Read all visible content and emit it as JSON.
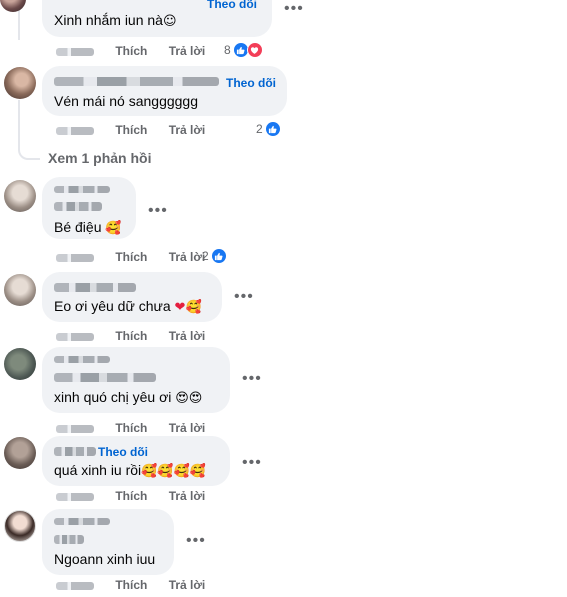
{
  "action_labels": {
    "like": "Thích",
    "reply": "Trả lời"
  },
  "follow_label": "Theo dõi",
  "view_replies_label": "Xem 1 phản hồi",
  "comments": [
    {
      "text": "Xinh nhắm iun nà",
      "emoji": "☺",
      "reaction_count": "8",
      "reactions": [
        "like",
        "love"
      ]
    },
    {
      "text": "Vén mái nó sangggggg",
      "reaction_count": "2",
      "reactions": [
        "like"
      ]
    },
    {
      "text": "Bé điệu",
      "emoji": "🥰",
      "reaction_count": "2",
      "reactions": [
        "like"
      ]
    },
    {
      "text": "Eo ơi yêu dữ chưa",
      "emoji": "❤🥰"
    },
    {
      "text": "xinh quó chị yêu ơi",
      "emoji": "😍😍"
    },
    {
      "text": "quá xinh iu rồi",
      "emoji": "🥰🥰🥰🥰"
    },
    {
      "text": "Ngoann xinh iuu"
    }
  ]
}
